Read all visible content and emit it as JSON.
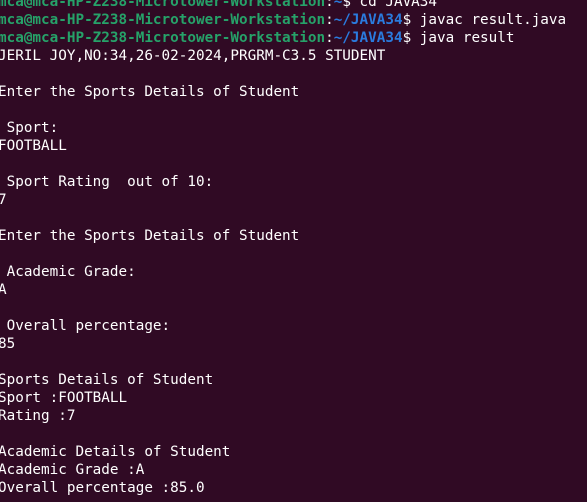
{
  "terminal": {
    "colors": {
      "background": "#300a24",
      "foreground": "#ffffff",
      "prompt_user": "#26a269",
      "prompt_path": "#2a7bde"
    },
    "prompt": {
      "user_host": "mca@mca-HP-Z238-Microtower-Workstation",
      "colon": ":",
      "symbol": "$ "
    },
    "commands": [
      {
        "path": "~",
        "command": "cd JAVA34"
      },
      {
        "path": "~/JAVA34",
        "command": "javac result.java"
      },
      {
        "path": "~/JAVA34",
        "command": "java result"
      }
    ],
    "output": [
      "JERIL JOY,NO:34,26-02-2024,PRGRM-C3.5 STUDENT",
      "",
      "Enter the Sports Details of Student",
      "",
      " Sport:",
      "FOOTBALL",
      "",
      " Sport Rating  out of 10:",
      "7",
      "",
      "Enter the Sports Details of Student",
      "",
      " Academic Grade:",
      "A",
      "",
      " Overall percentage:",
      "85",
      "",
      "Sports Details of Student",
      "Sport :FOOTBALL",
      "Rating :7",
      "",
      "Academic Details of Student",
      "Academic Grade :A",
      "Overall percentage :85.0"
    ]
  }
}
